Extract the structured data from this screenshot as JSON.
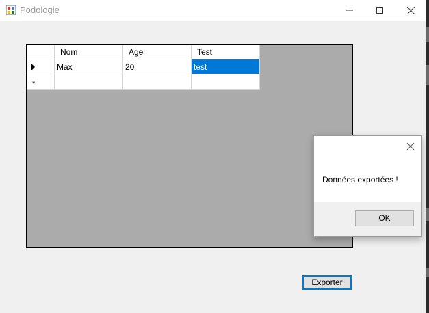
{
  "window": {
    "title": "Podologie",
    "icon": "winforms-app-icon",
    "controls": [
      "minimize-icon",
      "maximize-icon",
      "close-icon"
    ]
  },
  "grid": {
    "columns": [
      "Nom",
      "Age",
      "Test"
    ],
    "rows": [
      {
        "indicator": "current-row-arrow-icon",
        "cells": [
          "Max",
          "20",
          "test"
        ],
        "selected_cell": 2
      },
      {
        "indicator": "new-row-asterisk",
        "indicator_text": "*",
        "cells": [
          "",
          "",
          ""
        ]
      }
    ],
    "background_color": "#ababab",
    "selection_color": "#0078d7"
  },
  "buttons": {
    "export_label": "Exporter"
  },
  "dialog": {
    "message": "Données exportées !",
    "ok_label": "OK",
    "close_icon": "close-icon"
  }
}
